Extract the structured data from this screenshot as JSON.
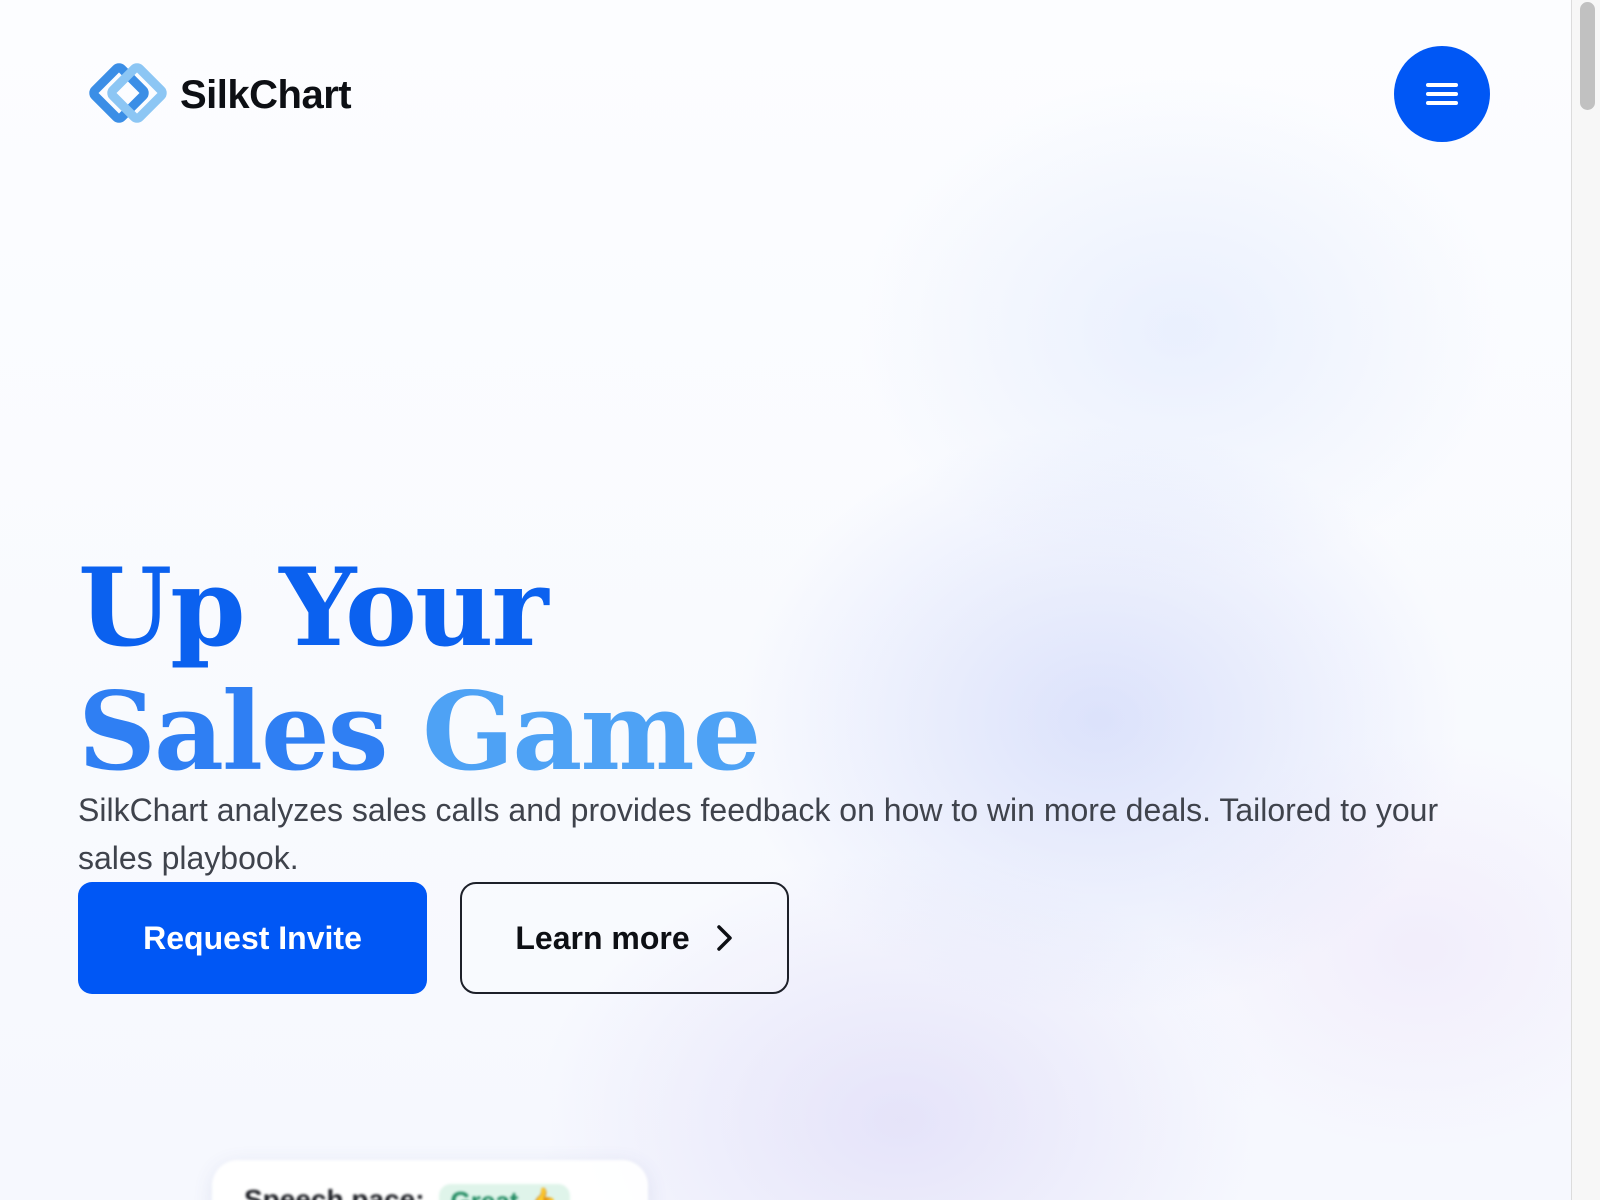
{
  "brand": {
    "name": "SilkChart",
    "logo_icon": "interlocked-diamonds-logo",
    "colors": {
      "primary": "#0057f5",
      "logo_dark": "#3b8ee6",
      "logo_light": "#8cc6f4"
    }
  },
  "header": {
    "menu_icon": "hamburger-menu-icon"
  },
  "hero": {
    "title_line1": "Up Your",
    "title_line2_word1": "Sales",
    "title_line2_word2": "Game",
    "subtitle": "SilkChart analyzes sales calls and provides feedback on how to win more deals. Tailored to your sales playbook.",
    "primary_button_label": "Request Invite",
    "secondary_button_label": "Learn more",
    "secondary_button_icon": "chevron-right-icon"
  },
  "preview_card": {
    "label": "Speech pace:",
    "badge": "Great 👍"
  }
}
